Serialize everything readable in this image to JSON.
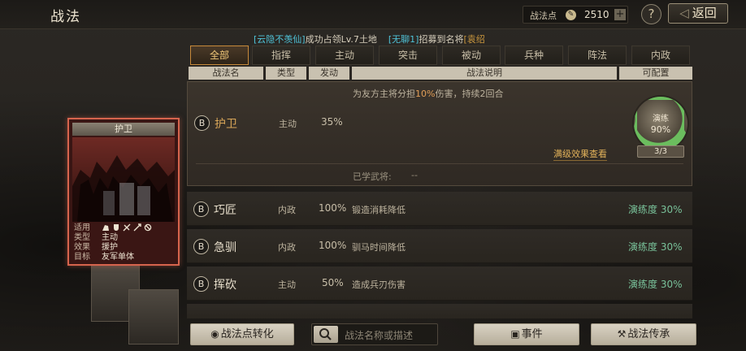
{
  "header": {
    "title": "战法",
    "points_label": "战法点",
    "points_value": "2510",
    "plus": "+",
    "help": "?",
    "back": "返回"
  },
  "announcement": {
    "part1": "[云隐不羡仙]",
    "part2": "成功占领Lv.7土地",
    "part3": "[无聊1]",
    "part4": "招募到名将",
    "part5": "[袁绍"
  },
  "tabs": [
    {
      "label": "全部",
      "active": true
    },
    {
      "label": "指挥",
      "active": false
    },
    {
      "label": "主动",
      "active": false
    },
    {
      "label": "突击",
      "active": false
    },
    {
      "label": "被动",
      "active": false
    },
    {
      "label": "兵种",
      "active": false
    },
    {
      "label": "阵法",
      "active": false
    },
    {
      "label": "内政",
      "active": false
    }
  ],
  "columns": {
    "name": "战法名",
    "type": "类型",
    "trigger": "发动",
    "description": "战法说明",
    "assignable": "可配置"
  },
  "expanded": {
    "grade": "B",
    "name": "护卫",
    "type": "主动",
    "trigger": "35%",
    "desc_before": "为友方主将分担",
    "desc_highlight": "10%",
    "desc_after": "伤害，持续2回合",
    "ring_label": "演练",
    "ring_value": "90%",
    "ring_progress": 0.9,
    "ring_count": "3/3",
    "full_effect_link": "满级效果查看",
    "learned_label": "已学武将:",
    "learned_value": "--"
  },
  "rows": [
    {
      "grade": "B",
      "name": "巧匠",
      "type": "内政",
      "trigger": "100%",
      "desc": "锻造消耗降低",
      "proficiency": "演练度 30%"
    },
    {
      "grade": "B",
      "name": "急驯",
      "type": "内政",
      "trigger": "100%",
      "desc": "驯马时间降低",
      "proficiency": "演练度 30%"
    },
    {
      "grade": "B",
      "name": "挥砍",
      "type": "主动",
      "trigger": "50%",
      "desc": "造成兵刃伤害",
      "proficiency": "演练度 30%"
    }
  ],
  "card": {
    "title": "护卫",
    "fit_key": "适用",
    "type_key": "类型",
    "type_val": "主动",
    "effect_key": "效果",
    "effect_val": "援护",
    "target_key": "目标",
    "target_val": "友军单体"
  },
  "bottom": {
    "convert": "战法点转化",
    "search_placeholder": "战法名称或描述",
    "events": "事件",
    "inherit": "战法传承"
  },
  "colors": {
    "accent": "#d9a658",
    "proficiency": "#79c29a",
    "card_border": "#d6644d",
    "ring": "#6bbd5e"
  }
}
